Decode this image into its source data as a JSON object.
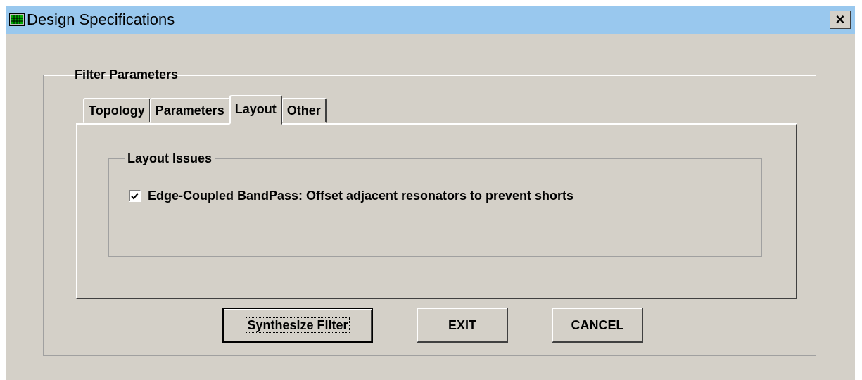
{
  "window": {
    "title": "Design Specifications",
    "close": "×"
  },
  "group": {
    "title": "Filter Parameters"
  },
  "tabs": [
    {
      "label": "Topology",
      "selected": false
    },
    {
      "label": "Parameters",
      "selected": false
    },
    {
      "label": "Layout",
      "selected": true
    },
    {
      "label": "Other",
      "selected": false
    }
  ],
  "layout_issues": {
    "title": "Layout Issues",
    "options": [
      {
        "label": "Edge-Coupled BandPass: Offset adjacent resonators to prevent shorts",
        "checked": true
      }
    ]
  },
  "buttons": [
    {
      "label": "Synthesize Filter",
      "focused": true
    },
    {
      "label": "EXIT",
      "focused": false
    },
    {
      "label": "CANCEL",
      "focused": false
    }
  ]
}
